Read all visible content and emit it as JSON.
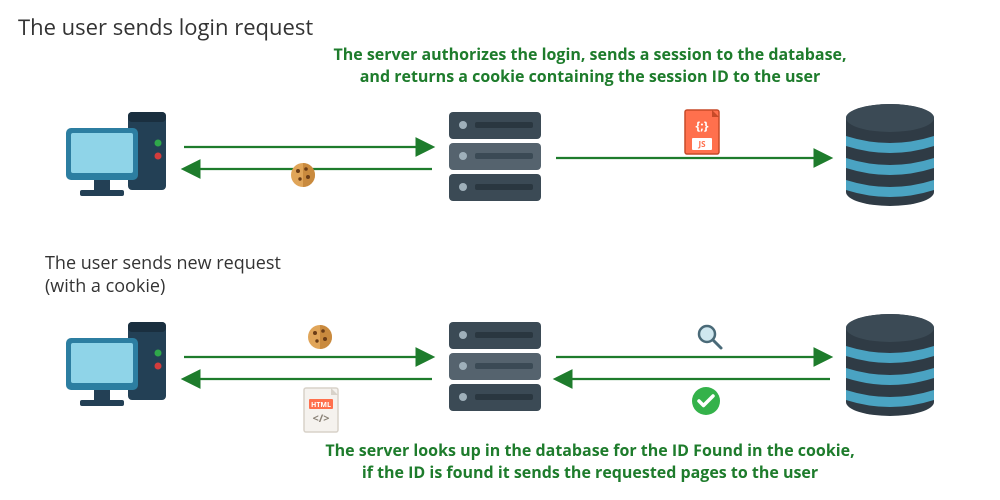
{
  "title": "The user sends login request",
  "explain_top": "The server authorizes the login, sends a session to the database,\nand returns a cookie containing the session ID to the user",
  "row2_title": "The user sends new request\n(with a cookie)",
  "explain_bottom": "The server looks up in the database for the ID Found in the cookie,\nif the ID is found it sends the requested pages to the user",
  "labels": {
    "js": "JS",
    "braces": "{;}",
    "html": "HTML",
    "code": "</>"
  },
  "colors": {
    "arrow": "#1e7c2c",
    "text_green": "#1e7c2c",
    "server_dark": "#3b4a55",
    "server_light": "#55636e",
    "db_dark": "#2f3b45",
    "db_band": "#4aa3c2",
    "monitor": "#2c7ea1",
    "tower": "#234055",
    "cookie": "#d18b3a",
    "js_bg": "#ff704d",
    "html_bg": "#eee",
    "check": "#34b24a"
  }
}
